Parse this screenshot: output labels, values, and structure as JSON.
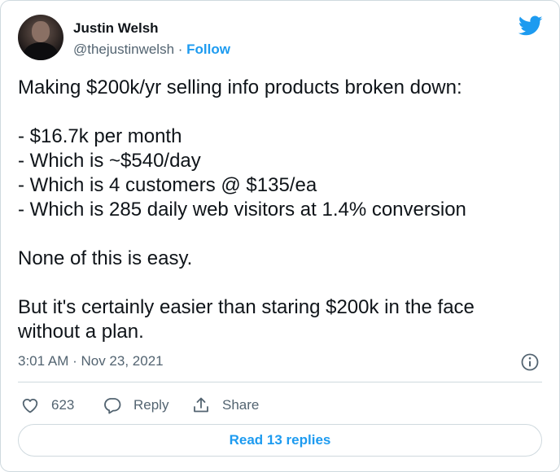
{
  "author": {
    "name": "Justin Welsh",
    "handle": "@thejustinwelsh",
    "separator": " · ",
    "follow_label": "Follow"
  },
  "tweet": {
    "lines": [
      "Making $200k/yr selling info products broken down:",
      "- $16.7k per month",
      "- Which is ~$540/day",
      "- Which is 4 customers @ $135/ea",
      "- Which is 285 daily web visitors at 1.4% conversion",
      "None of this is easy.",
      "But it's certainly easier than staring $200k in the face",
      "without a plan."
    ],
    "timestamp": "3:01 AM · Nov 23, 2021"
  },
  "actions": {
    "like_count": "623",
    "reply_label": "Reply",
    "share_label": "Share"
  },
  "read_replies_label": "Read 13 replies",
  "icons": {
    "brand": "twitter-bird-icon",
    "info": "info-icon",
    "like": "heart-icon",
    "reply": "reply-bubble-icon",
    "share": "share-upload-icon"
  },
  "colors": {
    "accent": "#1d9bf0",
    "text": "#0f1419",
    "secondary": "#536471",
    "border": "#cfd9de"
  }
}
